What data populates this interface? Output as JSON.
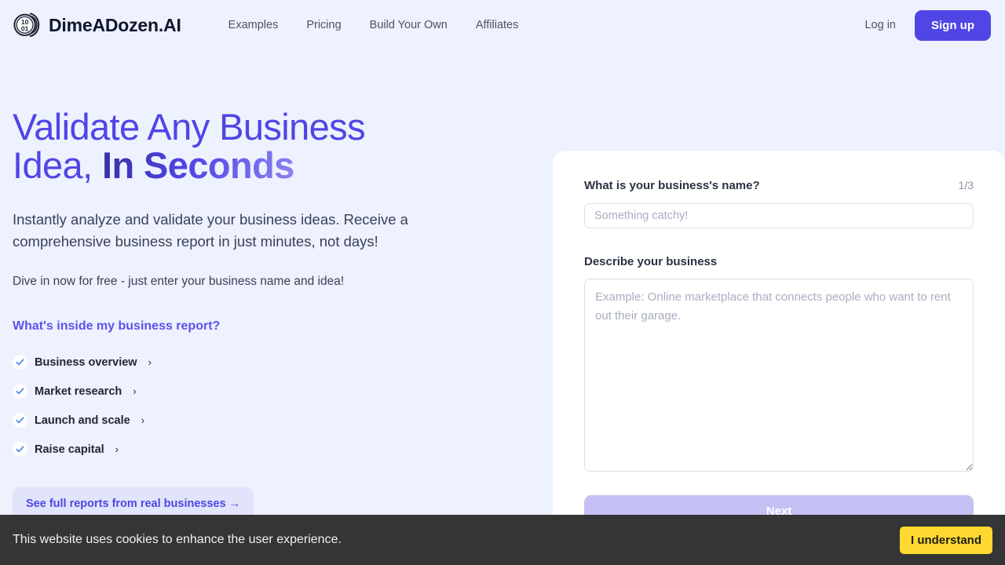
{
  "header": {
    "logo_icon": "binary-coin-icon",
    "logo_top_digits": "10",
    "logo_bottom_digits": "01",
    "brand_name": "DimeADozen.AI",
    "nav": [
      {
        "label": "Examples"
      },
      {
        "label": "Pricing"
      },
      {
        "label": "Build Your Own"
      },
      {
        "label": "Affiliates"
      }
    ],
    "login_label": "Log in",
    "signup_label": "Sign up"
  },
  "hero": {
    "title_part1": "Validate Any Business Idea, ",
    "title_accent": "In Seconds",
    "subtitle": "Instantly analyze and validate your business ideas. Receive a comprehensive business report in just minutes, not days!",
    "note": "Dive in now for free - just enter your business name and idea!",
    "report_heading": "What's inside my business report?",
    "report_items": [
      {
        "label": "Business overview",
        "chevron": "›",
        "check_icon": "check-icon"
      },
      {
        "label": "Market research",
        "chevron": "›",
        "check_icon": "check-icon"
      },
      {
        "label": "Launch and scale",
        "chevron": "›",
        "check_icon": "check-icon"
      },
      {
        "label": "Raise capital",
        "chevron": "›",
        "check_icon": "check-icon"
      }
    ],
    "reports_cta": "See full reports from real businesses →"
  },
  "form": {
    "name_label": "What is your business's name?",
    "step_counter": "1/3",
    "name_value": "",
    "name_placeholder": "Something catchy!",
    "describe_label": "Describe your business",
    "describe_value": "",
    "describe_placeholder": "Example: Online marketplace that connects people who want to rent out their garage.",
    "next_label": "Next"
  },
  "cookie": {
    "message": "This website uses cookies to enhance the user experience.",
    "accept_label": "I understand"
  },
  "colors": {
    "page_background": "#eef1fe",
    "brand_accent": "#4f46e5",
    "card_background": "#ffffff",
    "next_disabled": "#c5c0f3",
    "cookie_background": "#353535",
    "cookie_accept": "#ffd92f"
  }
}
